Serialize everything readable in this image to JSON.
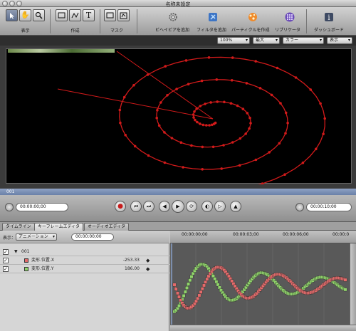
{
  "window": {
    "title": "名称未設定"
  },
  "toolbar": {
    "groups": [
      {
        "label": "表示"
      },
      {
        "label": "作成"
      },
      {
        "label": "マスク"
      }
    ],
    "actions": [
      {
        "label": "ビヘイビアを追加",
        "icon": "gear-icon"
      },
      {
        "label": "フィルタを追加",
        "icon": "filter-icon"
      },
      {
        "label": "パーティクルを作成",
        "icon": "particle-icon"
      },
      {
        "label": "リプリケータ",
        "icon": "replicator-icon"
      },
      {
        "label": "ダッシュボード",
        "icon": "info-icon"
      }
    ]
  },
  "canvas_controls": {
    "zoom": "100%",
    "quality": "最大",
    "channel": "カラー",
    "view": "表示"
  },
  "timeline_bar": {
    "label": "001"
  },
  "transport": {
    "current_timecode": "00:00:00;00",
    "duration_timecode": "00:00:10;00"
  },
  "tabs": [
    {
      "label": "タイムライン",
      "active": false
    },
    {
      "label": "キーフレームエディタ",
      "active": true
    },
    {
      "label": "オーディオエディタ",
      "active": false
    }
  ],
  "keyframe_editor": {
    "show_label": "表示：",
    "show_value": "アニメーション",
    "timecode": "00:00:00;00",
    "object_name": "001",
    "params": [
      {
        "name": "変形.位置.X",
        "value": "-253.33",
        "color": "#e36a6a"
      },
      {
        "name": "変形.位置.Y",
        "value": "186.00",
        "color": "#8fd36a"
      }
    ],
    "ruler": [
      "00:00:00;00",
      "00:00:03;00",
      "00:00:06;00",
      "00:00:0"
    ]
  },
  "colors": {
    "path_red": "#d11a1a",
    "x_curve": "#e36a6a",
    "y_curve": "#8fd36a"
  }
}
